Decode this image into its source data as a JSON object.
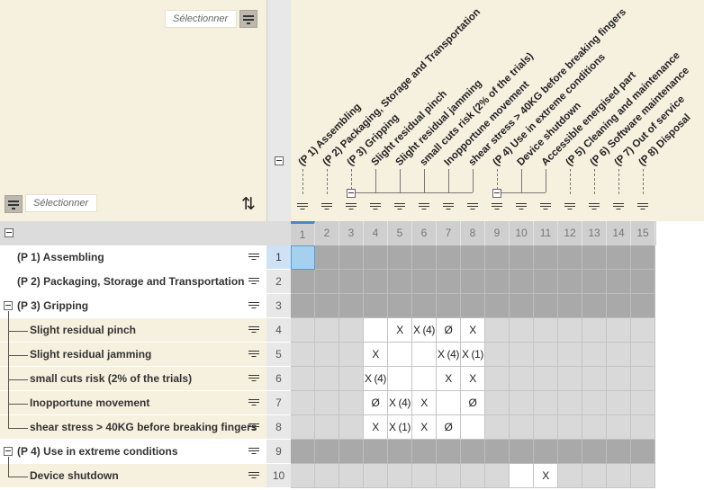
{
  "select_top": {
    "placeholder": "Sélectionner"
  },
  "select_bottom": {
    "placeholder": "Sélectionner"
  },
  "columns": [
    {
      "num": "1",
      "label": "(P 1) Assembling"
    },
    {
      "num": "2",
      "label": "(P 2) Packaging, Storage and Transportation"
    },
    {
      "num": "3",
      "label": "(P 3) Gripping"
    },
    {
      "num": "4",
      "label": "Slight residual pinch"
    },
    {
      "num": "5",
      "label": "Slight residual jamming"
    },
    {
      "num": "6",
      "label": "small cuts risk (2% of the trials)"
    },
    {
      "num": "7",
      "label": "Inopportune movement"
    },
    {
      "num": "8",
      "label": "shear stress > 40KG before breaking fingers"
    },
    {
      "num": "9",
      "label": "(P 4) Use in extreme conditions"
    },
    {
      "num": "10",
      "label": "Device shutdown"
    },
    {
      "num": "11",
      "label": "Accessible energised part"
    },
    {
      "num": "12",
      "label": "(P 5) Cleaning and maintenance"
    },
    {
      "num": "13",
      "label": "(P 6) Software maintenance"
    },
    {
      "num": "14",
      "label": "(P 7) Out of service"
    },
    {
      "num": "15",
      "label": "(P 8) Disposal"
    }
  ],
  "rows": [
    {
      "num": "1",
      "label": "(P 1) Assembling",
      "type": "group",
      "cells": [
        "",
        "",
        "",
        "",
        "",
        "",
        "",
        "",
        "",
        "",
        "",
        "",
        "",
        "",
        ""
      ]
    },
    {
      "num": "2",
      "label": "(P 2) Packaging, Storage and Transportation",
      "type": "group",
      "cells": [
        "",
        "",
        "",
        "",
        "",
        "",
        "",
        "",
        "",
        "",
        "",
        "",
        "",
        "",
        ""
      ]
    },
    {
      "num": "3",
      "label": "(P 3) Gripping",
      "type": "group",
      "cells": [
        "",
        "",
        "",
        "",
        "",
        "",
        "",
        "",
        "",
        "",
        "",
        "",
        "",
        "",
        ""
      ]
    },
    {
      "num": "4",
      "label": "Slight residual pinch",
      "type": "item",
      "cells": [
        "",
        "",
        "",
        "",
        "X",
        "X (4)",
        "Ø",
        "X",
        "",
        "",
        "",
        "",
        "",
        "",
        ""
      ]
    },
    {
      "num": "5",
      "label": "Slight residual jamming",
      "type": "item",
      "cells": [
        "",
        "",
        "",
        "X",
        "",
        "",
        "X (4)",
        "X (1)",
        "",
        "",
        "",
        "",
        "",
        "",
        ""
      ]
    },
    {
      "num": "6",
      "label": "small cuts risk (2% of the trials)",
      "type": "item",
      "cells": [
        "",
        "",
        "",
        "X (4)",
        "",
        "",
        "X",
        "X",
        "",
        "",
        "",
        "",
        "",
        "",
        ""
      ]
    },
    {
      "num": "7",
      "label": "Inopportune movement",
      "type": "item",
      "cells": [
        "",
        "",
        "",
        "Ø",
        "X (4)",
        "X",
        "",
        "Ø",
        "",
        "",
        "",
        "",
        "",
        "",
        ""
      ]
    },
    {
      "num": "8",
      "label": "shear stress > 40KG before breaking fingers",
      "type": "item",
      "cells": [
        "",
        "",
        "",
        "X",
        "X (1)",
        "X",
        "Ø",
        "",
        "",
        "",
        "",
        "",
        "",
        "",
        ""
      ]
    },
    {
      "num": "9",
      "label": "(P 4) Use in extreme conditions",
      "type": "group",
      "cells": [
        "",
        "",
        "",
        "",
        "",
        "",
        "",
        "",
        "",
        "",
        "",
        "",
        "",
        "",
        ""
      ]
    },
    {
      "num": "10",
      "label": "Device shutdown",
      "type": "item",
      "cells": [
        "",
        "",
        "",
        "",
        "",
        "",
        "",
        "",
        "",
        "",
        "X",
        "",
        "",
        "",
        ""
      ]
    }
  ]
}
